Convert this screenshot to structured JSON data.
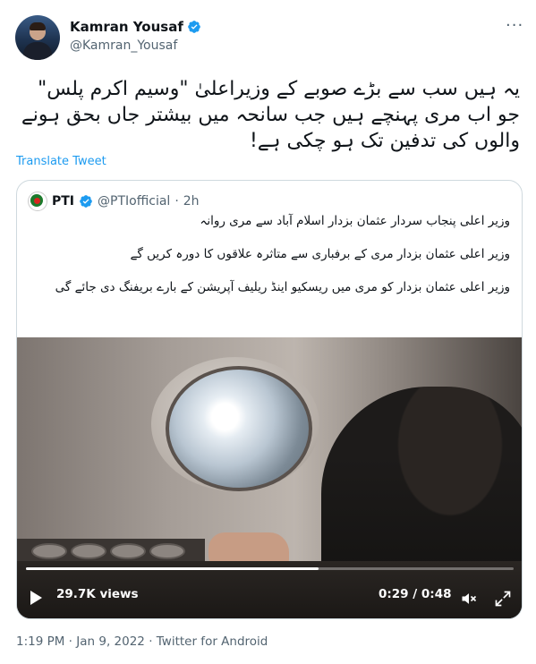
{
  "author": {
    "name": "Kamran Yousaf",
    "handle": "@Kamran_Yousaf"
  },
  "tweet": {
    "text": "یہ ہیں سب سے بڑے صوبے کے وزیراعلیٰ \"وسیم اکرم پلس\" جو اب مری پہنچے ہیں جب سانحہ میں بیشتر جاں بحق ہونے والوں کی تدفین تک ہو چکی ہے!",
    "translate_label": "Translate Tweet"
  },
  "quote": {
    "name": "PTI",
    "handle": "@PTIofficial",
    "separator": "·",
    "time": "2h",
    "paragraphs": [
      "وزیر اعلی پنجاب سردار عثمان بزدار اسلام آباد سے مری روانہ",
      "وزیر اعلی عثمان بزدار مری کے برفباری سے متاثرہ علاقوں کا دورہ کریں گے",
      "وزیر اعلی عثمان بزدار کو مری میں ریسکیو اینڈ ریلیف آپریشن کے بارے بریفنگ دی جائے گی"
    ]
  },
  "video": {
    "views": "29.7K views",
    "time": "0:29 / 0:48",
    "progress": 0.6
  },
  "footer": {
    "timestamp": "1:19 PM · Jan 9, 2022 · Twitter for Android"
  },
  "icons": {
    "verified": "verified-badge-icon",
    "more": "more-options-icon",
    "play": "play-icon",
    "mute": "mute-icon",
    "expand": "fullscreen-icon"
  },
  "colors": {
    "accent": "#1d9bf0",
    "secondary_text": "#536471",
    "border": "#cfd9de"
  }
}
